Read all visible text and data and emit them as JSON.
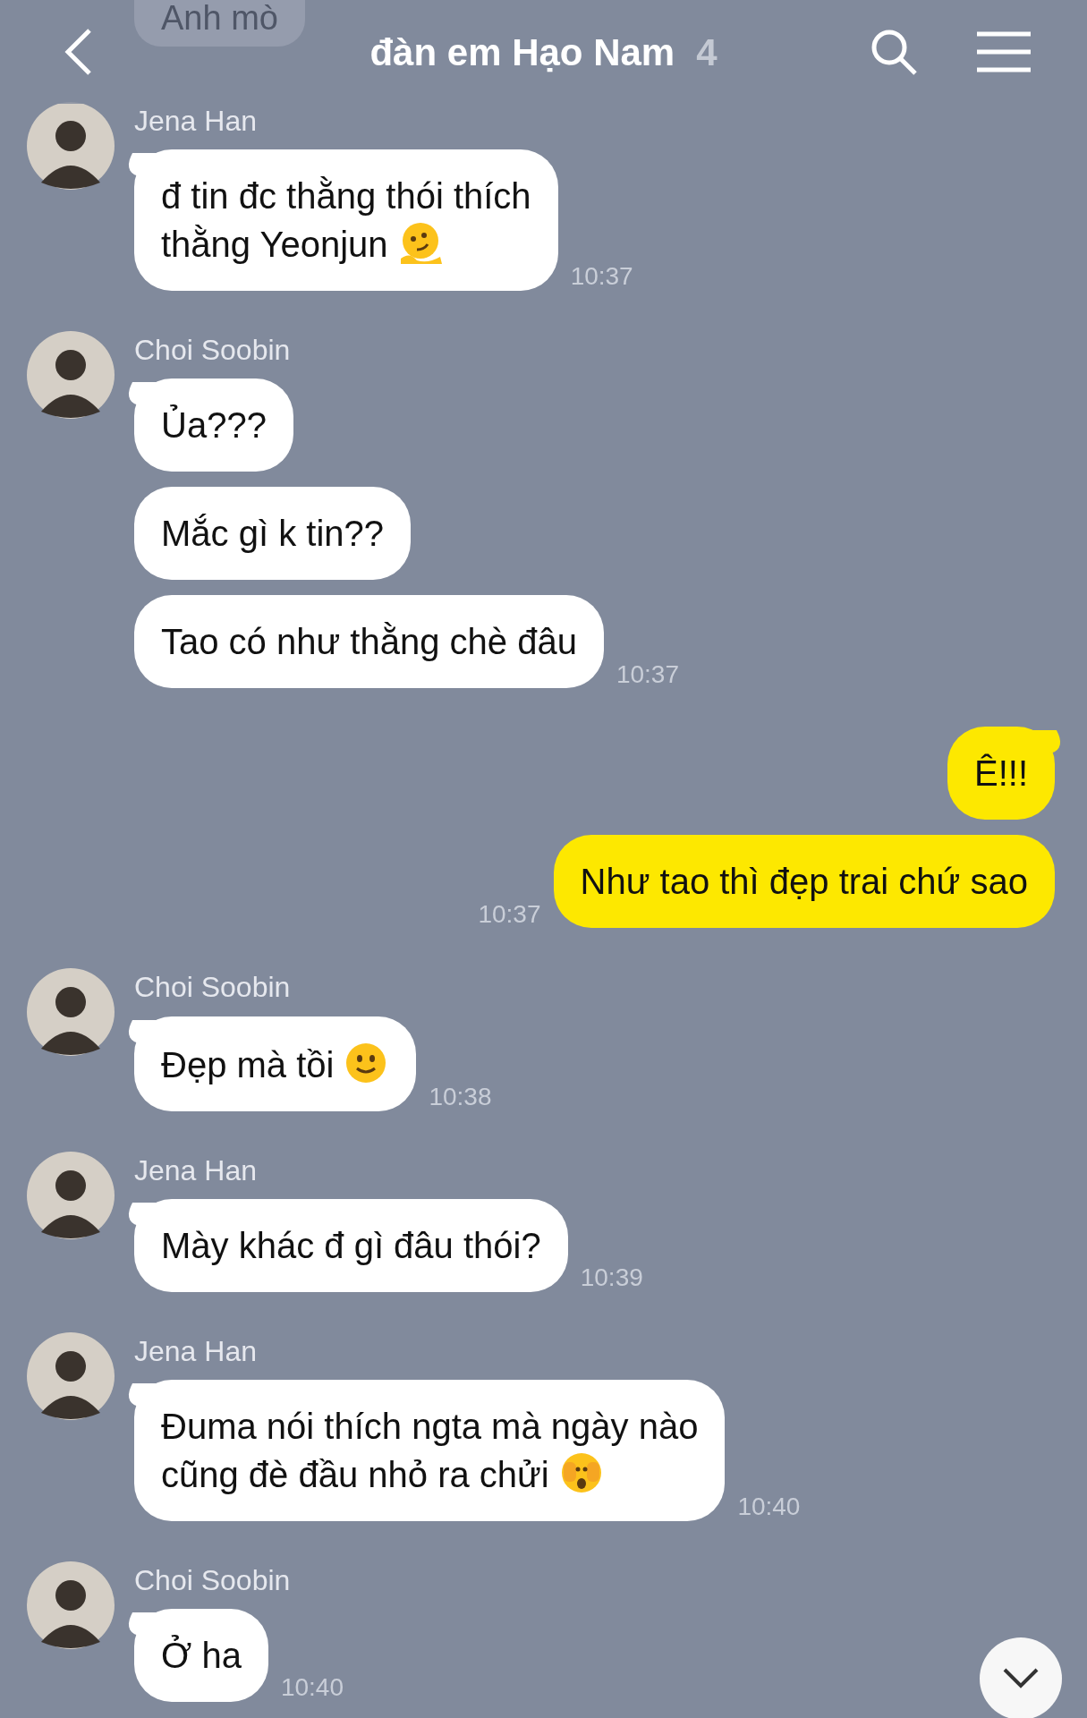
{
  "header": {
    "title": "đàn em Hạo Nam",
    "member_count": "4"
  },
  "faded_message": {
    "text": "Anh mò"
  },
  "groups": [
    {
      "kind": "incoming",
      "sender": "Jena Han",
      "time": "10:37",
      "messages": [
        {
          "kind": "melting",
          "text": "đ tin đc thằng thói thích\nthằng Yeonjun"
        }
      ]
    },
    {
      "kind": "incoming",
      "sender": "Choi Soobin",
      "time": "10:37",
      "messages": [
        {
          "kind": "plain",
          "text": "Ủa???"
        },
        {
          "kind": "plain",
          "text": "Mắc gì k tin??"
        },
        {
          "kind": "plain",
          "text": "Tao có như thằng chè đâu"
        }
      ]
    },
    {
      "kind": "outgoing",
      "time": "10:37",
      "messages": [
        {
          "kind": "plain",
          "text": "Ê!!!"
        },
        {
          "kind": "plain",
          "text": "Như tao thì đẹp trai chứ sao"
        }
      ]
    },
    {
      "kind": "incoming",
      "sender": "Choi Soobin",
      "time": "10:38",
      "messages": [
        {
          "kind": "smile",
          "text": "Đẹp mà tồi"
        }
      ]
    },
    {
      "kind": "incoming",
      "sender": "Jena Han",
      "time": "10:39",
      "messages": [
        {
          "kind": "plain",
          "text": "Mày khác đ gì đâu thói?"
        }
      ]
    },
    {
      "kind": "incoming",
      "sender": "Jena Han",
      "time": "10:40",
      "messages": [
        {
          "kind": "peek",
          "text": "Đuma nói thích ngta mà ngày nào\ncũng đè đầu nhỏ ra chửi"
        }
      ]
    },
    {
      "kind": "incoming",
      "sender": "Choi Soobin",
      "time": "10:40",
      "messages": [
        {
          "kind": "plain",
          "text": "Ở ha"
        }
      ]
    }
  ]
}
